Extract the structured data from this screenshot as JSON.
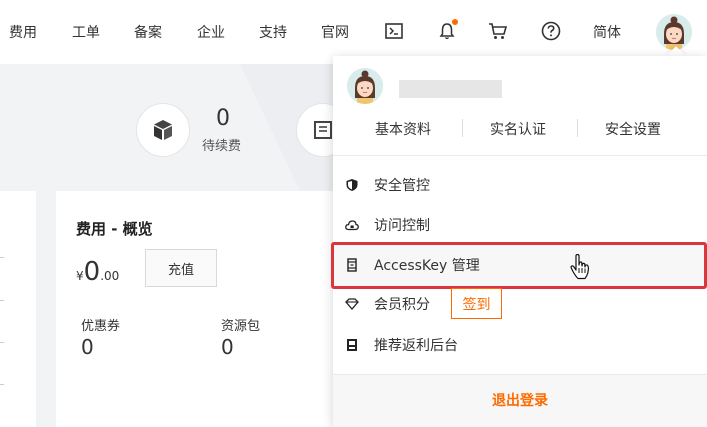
{
  "nav": {
    "items": [
      "费用",
      "工单",
      "备案",
      "企业",
      "支持",
      "官网"
    ],
    "lang": "简体",
    "icons": [
      "terminal-icon",
      "bell-icon",
      "cart-icon",
      "help-icon"
    ],
    "accent": "#ff6a00"
  },
  "dashboard": {
    "renew_count": "0",
    "renew_label": "待续费",
    "card": {
      "title": "费用 - 概览",
      "currency": "¥",
      "balance_int": "0",
      "balance_dec": ".00",
      "recharge_label": "充值",
      "coupon_label": "优惠券",
      "coupon_value": "0",
      "package_label": "资源包",
      "package_value": "0"
    }
  },
  "account_menu": {
    "profile_links": [
      "基本资料",
      "实名认证",
      "安全设置"
    ],
    "items": [
      {
        "label": "安全管控",
        "icon": "shield-icon"
      },
      {
        "label": "访问控制",
        "icon": "cloud-lock-icon"
      },
      {
        "label": "AccessKey 管理",
        "icon": "key-icon"
      },
      {
        "label": "会员积分",
        "icon": "diamond-icon"
      },
      {
        "label": "推荐返利后台",
        "icon": "rebate-icon"
      }
    ],
    "sign_in_label": "签到",
    "logout_label": "退出登录"
  }
}
